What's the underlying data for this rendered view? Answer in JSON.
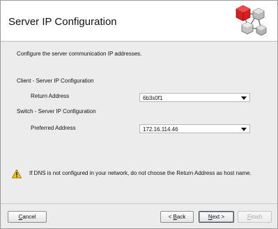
{
  "header": {
    "title": "Server IP Configuration",
    "icon": "network-servers-icon"
  },
  "intro": "Configure the server communication IP addresses.",
  "client_section": {
    "title": "Client - Server IP Configuration",
    "return_address_label": "Return Address",
    "return_address_value": "6b3s0f1"
  },
  "switch_section": {
    "title": "Switch - Server IP Configuration",
    "preferred_address_label": "Preferred Address",
    "preferred_address_value": "172.16.114.46"
  },
  "warning": {
    "icon": "warning-icon",
    "text": "If DNS is not configured in your network, do not choose the Return Address as host name."
  },
  "buttons": {
    "cancel_first": "C",
    "cancel_rest": "ancel",
    "back_pre": "< ",
    "back_ul": "B",
    "back_post": "ack",
    "next_ul": "N",
    "next_post": "ext >",
    "finish_ul": "F",
    "finish_post": "inish"
  },
  "colors": {
    "header_bg": "#ffffff",
    "body_bg": "#ececec",
    "icon_red": "#d42020",
    "warning_yellow": "#f2c200"
  }
}
